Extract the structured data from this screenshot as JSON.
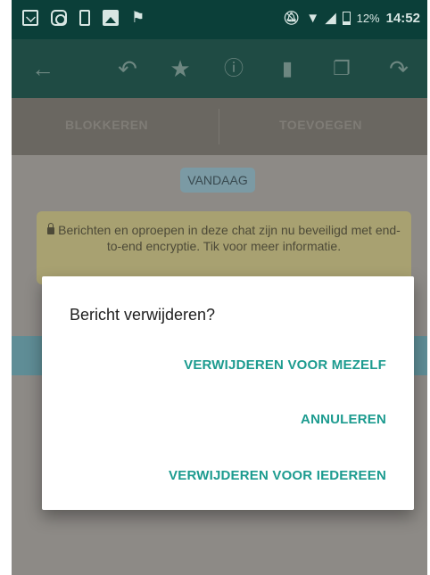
{
  "status_bar": {
    "left_icons": [
      "mail-icon",
      "instagram-icon",
      "phone-icon",
      "gallery-icon",
      "flag-icon"
    ],
    "right_icons": [
      "mute-icon",
      "wifi-icon",
      "signal-icon",
      "battery-icon"
    ],
    "battery": "12%",
    "time": "14:52"
  },
  "app_bar": {
    "icons": [
      "back-arrow-icon",
      "reply-icon",
      "star-icon",
      "info-icon",
      "delete-icon",
      "copy-icon",
      "forward-icon"
    ]
  },
  "action_bar": {
    "block_label": "BLOKKEREN",
    "add_label": "TOEVOEGEN"
  },
  "chat": {
    "date_chip": "VANDAAG",
    "encryption_notice": "Berichten en oproepen in deze chat zijn nu beveiligd met end-to-end encryptie. Tik voor meer informatie."
  },
  "dialog": {
    "title": "Bericht verwijderen?",
    "buttons": {
      "delete_for_me": "VERWIJDEREN VOOR MEZELF",
      "cancel": "ANNULEREN",
      "delete_for_everyone": "VERWIJDEREN VOOR IEDEREEN"
    }
  },
  "colors": {
    "status_bar": "#0b3f39",
    "accent": "#1c9b8f",
    "scrim_dimmed_toolbar": "#1f4b44"
  }
}
